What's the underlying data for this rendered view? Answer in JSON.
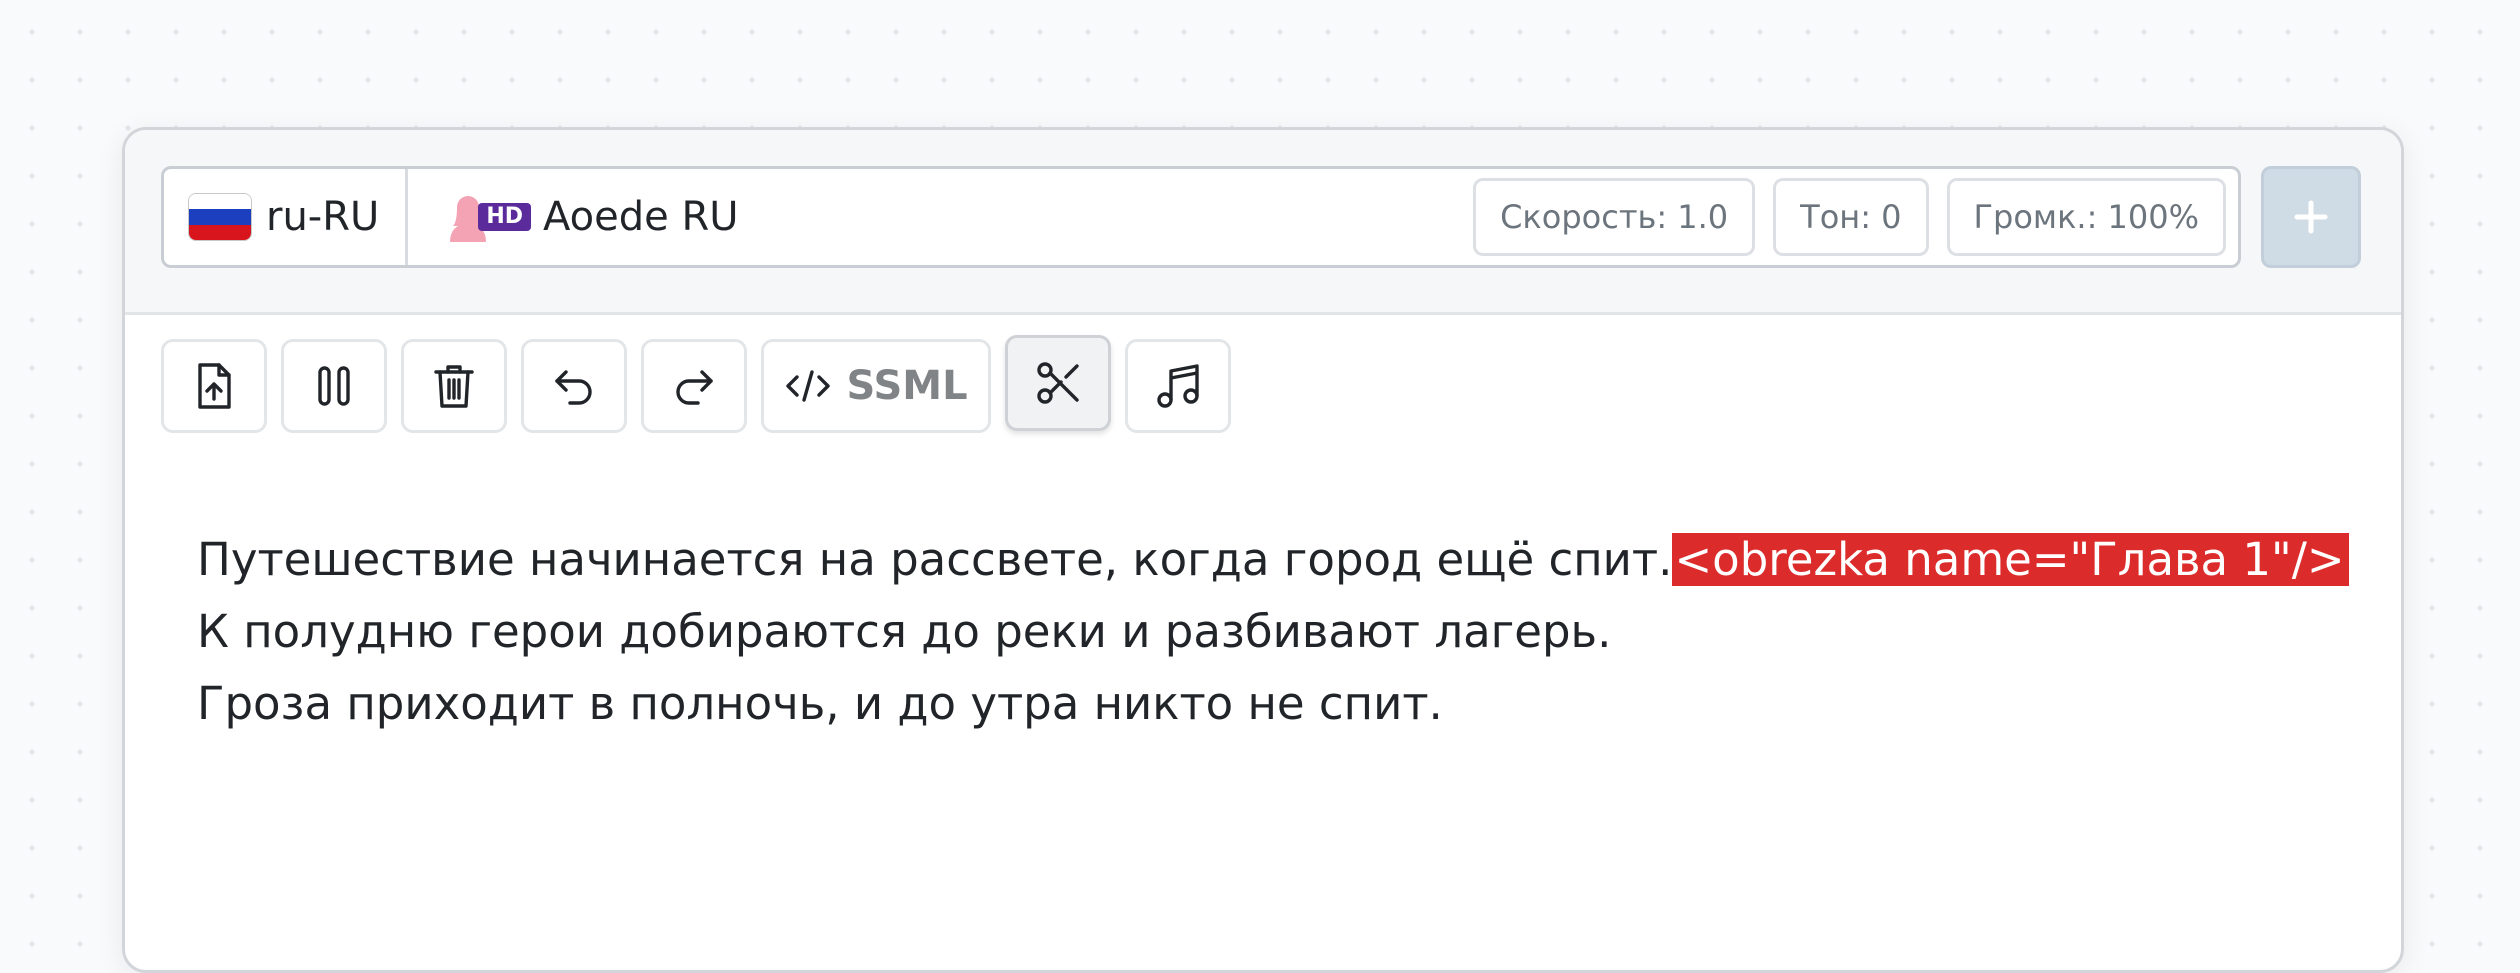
{
  "voice_bar": {
    "locale": "ru-RU",
    "flag_icon": "russia-flag-icon",
    "voice_name": "Aoede RU",
    "voice_icon": "female-voice-icon",
    "hd_badge": "HD",
    "speed": "Скорость: 1.0",
    "pitch": "Тон: 0",
    "volume": "Громк.: 100%",
    "add_icon": "plus-icon"
  },
  "toolbar": {
    "buttons": [
      {
        "icon": "upload-file-icon"
      },
      {
        "icon": "pause-icon"
      },
      {
        "icon": "trash-icon"
      },
      {
        "icon": "undo-icon"
      },
      {
        "icon": "redo-icon"
      },
      {
        "icon": "code-icon",
        "label": "SSML"
      },
      {
        "icon": "scissors-icon",
        "active": true
      },
      {
        "icon": "music-note-icon"
      }
    ]
  },
  "editor": {
    "lines": [
      {
        "text": "Путешествие начинается на рассвете, когда город ещё спит.",
        "tag": "<obrezka name=\"Глава 1\"/>"
      },
      {
        "text": "К полудню герои добираются до реки и разбивают лагерь."
      },
      {
        "text": "Гроза приходит в полночь, и до утра никто не спит."
      }
    ]
  },
  "colors": {
    "tag_background": "#dc2b2b",
    "hd_badge": "#5b2b9c",
    "avatar": "#f4a3b4",
    "add_button": "#cfdbe5"
  }
}
